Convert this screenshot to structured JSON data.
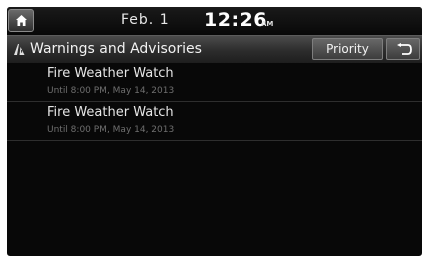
{
  "statusbar": {
    "home_icon": "home-icon",
    "date": "Feb.  1",
    "time": "12:26",
    "ampm": "AM"
  },
  "header": {
    "icon": "warning-road-icon",
    "title": "Warnings and Advisories",
    "priority_label": "Priority",
    "back_icon": "back-arrow-icon"
  },
  "alerts": [
    {
      "title": "Fire Weather Watch",
      "subtitle": "Until 8:00 PM, May 14, 2013"
    },
    {
      "title": "Fire Weather Watch",
      "subtitle": "Until 8:00 PM, May 14, 2013"
    }
  ],
  "colors": {
    "background": "#080808",
    "text": "#e6e6e6",
    "subtext": "#6f6f6f"
  }
}
